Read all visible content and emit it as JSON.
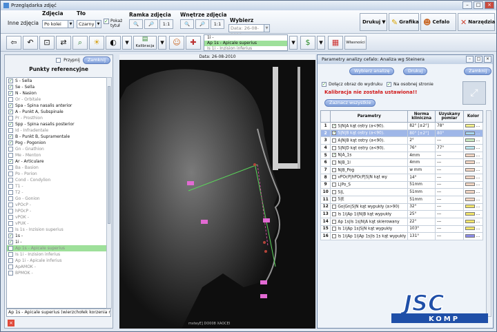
{
  "window": {
    "title": "Przeglądarka zdjęć"
  },
  "ribbon": {
    "inne_zdjecia": "Inne zdjęcia",
    "zdjecia_label": "Zdjęcia",
    "zdjecia_value": "Po kolei",
    "tlo_label": "Tło",
    "tlo_value": "Czarny",
    "pokaz_tytul": "Pokaż tytuł",
    "ramka_label": "Ramka zdjęcia",
    "wnetrze_label": "Wnętrze zdjęcia",
    "zoom_1to1": "1:1",
    "wybierz_label": "Wybierz",
    "wybierz_value": "Data: 26-08-2010",
    "drukuj": "Drukuj",
    "grafika": "Grafika",
    "cefalo": "Cefalo",
    "narzedzia": "Narzędzia"
  },
  "toolbar": {
    "kalibracja": "Kalibracja",
    "wlasnosci": "Własności",
    "point_dropdown": [
      "1i -",
      "Ap 1s - Apicale superius",
      "Is 1i - Inzision inferius"
    ]
  },
  "left_panel": {
    "przypnij": "Przypnij",
    "zamknij": "Zamknij",
    "title": "Punkty referencyjne",
    "points": [
      {
        "label": "S - Sella",
        "checked": true
      },
      {
        "label": "Se - Sella",
        "checked": true
      },
      {
        "label": "N - Nasion",
        "checked": true
      },
      {
        "label": "Or - Orbitale",
        "checked": false
      },
      {
        "label": "Spa - Spina nasalis anterior",
        "checked": true
      },
      {
        "label": "A - Punkt A, Subspinale",
        "checked": true
      },
      {
        "label": "Pr - Prosthion",
        "checked": false
      },
      {
        "label": "Spp - Spina nasalis posterior",
        "checked": true
      },
      {
        "label": "Id - Infradentale",
        "checked": false
      },
      {
        "label": "B - Punkt B, Supramentale",
        "checked": true
      },
      {
        "label": "Pog - Pogonion",
        "checked": true
      },
      {
        "label": "Gn - Gnathion",
        "checked": false
      },
      {
        "label": "Me - Menton",
        "checked": false
      },
      {
        "label": "Ar - Articulare",
        "checked": true
      },
      {
        "label": "Ba - Basion",
        "checked": false
      },
      {
        "label": "Po - Porion",
        "checked": false
      },
      {
        "label": "Cond - Condylion",
        "checked": false
      },
      {
        "label": "T1 -",
        "checked": false
      },
      {
        "label": "T2 -",
        "checked": false
      },
      {
        "label": "Go - Gonion",
        "checked": false
      },
      {
        "label": "vPOcP -",
        "checked": false
      },
      {
        "label": "hPOcP -",
        "checked": false
      },
      {
        "label": "vPOK -",
        "checked": false
      },
      {
        "label": "vPUK -",
        "checked": false
      },
      {
        "label": "Is 1s - Inzision superius",
        "checked": false
      },
      {
        "label": "1s -",
        "checked": true
      },
      {
        "label": "1i -",
        "checked": true
      },
      {
        "label": "Ap 1s - Apicale superius",
        "checked": false,
        "selected": true
      },
      {
        "label": "Is 1i - Inzision inferius",
        "checked": false
      },
      {
        "label": "Ap 1i - Apicale inferius",
        "checked": false
      },
      {
        "label": "ApAMOK -",
        "checked": false
      },
      {
        "label": "BPMOK -",
        "checked": false
      }
    ],
    "status": "Ap 1s - Apicale superius  (wierzchołek korzenia najb"
  },
  "xray": {
    "date": "Data: 26-08-2010",
    "caption": "mxteyE] DO008 XAOCEI"
  },
  "dialog": {
    "title": "Parametry analizy cefalo: Analiza wg Steinera",
    "wybierz_analize": "Wybierz analizę",
    "drukuj": "Drukuj",
    "zamknij": "Zamknij",
    "dolacz": "Dołącz obraz do wydruku",
    "osobnej": "Na osobnej stronie",
    "warning": "Kalibracja nie została ustawiona!!",
    "zaznacz": "Zaznacz wszystkie",
    "headers": [
      "Parametry",
      "Norma kliniczna",
      "Uzyskany pomiar",
      "Kolor"
    ],
    "rows": [
      {
        "n": "1",
        "p": "S|N|A kąt ostry (a<90).",
        "norm": "82° [±2°]",
        "val": "78°",
        "color": "#f4f08a",
        "chk": true
      },
      {
        "n": "2",
        "p": "S|N|B kąt ostry (a<90).",
        "norm": "80° [±2°]",
        "val": "80°",
        "color": "#a8d8f0",
        "chk": true,
        "sel": true
      },
      {
        "n": "3",
        "p": "A|N|B kąt ostry (a<90).",
        "norm": "2°",
        "val": "---",
        "color": "#c9e9c1",
        "chk": false
      },
      {
        "n": "4",
        "p": "S|N|D kąt ostry (a<90).",
        "norm": "76°",
        "val": "77°",
        "color": "#b9e6ef",
        "chk": false
      },
      {
        "n": "5",
        "p": "N|A_1s",
        "norm": "4mm",
        "val": "---",
        "color": "#f3d6c3",
        "chk": true
      },
      {
        "n": "6",
        "p": "N|B_1i",
        "norm": "4mm",
        "val": "---",
        "color": "#f3d6c3",
        "chk": false
      },
      {
        "n": "7",
        "p": "N|B_Pog",
        "norm": "w mm",
        "val": "---",
        "color": "#f3d6c3",
        "chk": false
      },
      {
        "n": "8",
        "p": "vPOcP|hPOcP|S|N kąt wy",
        "norm": "14°",
        "val": "---",
        "color": "#f3d6c3",
        "chk": false
      },
      {
        "n": "9",
        "p": "L|Po_S",
        "norm": "51mm",
        "val": "---",
        "color": "#f3d6c3",
        "chk": false
      },
      {
        "n": "10",
        "p": "S|L",
        "norm": "51mm",
        "val": "---",
        "color": "#f3d6c3",
        "chk": false
      },
      {
        "n": "11",
        "p": "S|E",
        "norm": "51mm",
        "val": "---",
        "color": "#f3d6c3",
        "chk": false
      },
      {
        "n": "12",
        "p": "Go|Gn|S|N kąt wypukły (a>90)",
        "norm": "32°",
        "val": "---",
        "color": "#f2e56a",
        "chk": false
      },
      {
        "n": "13",
        "p": "Is 1i|Ap 1i|N|B kąt wypukły",
        "norm": "25°",
        "val": "---",
        "color": "#f2e56a",
        "chk": false
      },
      {
        "n": "14",
        "p": "Ap 1s|Is 1s|N|A kąt skierowany",
        "norm": "22°",
        "val": "---",
        "color": "#f2e56a",
        "chk": false
      },
      {
        "n": "15",
        "p": "Is 1i|Ap 1s|S|N kąt wypukły",
        "norm": "103°",
        "val": "---",
        "color": "#f2e56a",
        "chk": false
      },
      {
        "n": "16",
        "p": "Is 1i|Ap 1i|Ap 1s|Is 1s kąt wypukły",
        "norm": "131°",
        "val": "---",
        "color": "#8b8be8",
        "chk": false
      }
    ]
  },
  "logo": {
    "line1": "JSC",
    "line2": "KOMP"
  }
}
